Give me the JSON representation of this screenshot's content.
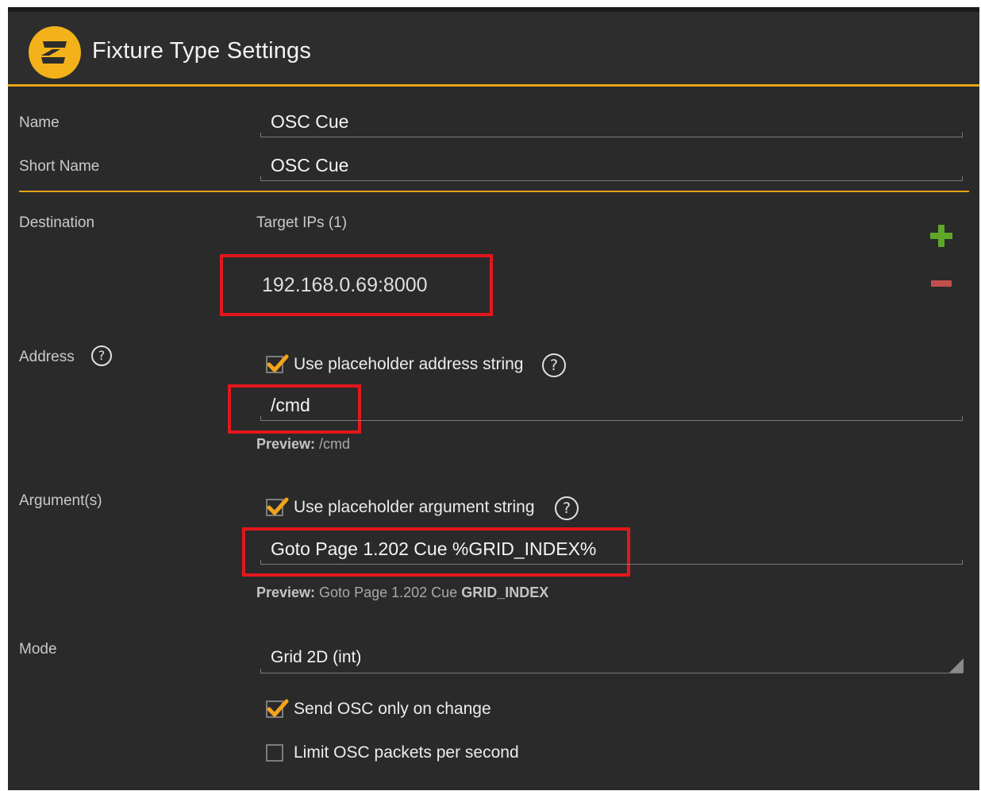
{
  "header": {
    "title": "Fixture Type Settings",
    "logo_icon": "app-logo-icon"
  },
  "name_row": {
    "label": "Name",
    "value": "OSC Cue"
  },
  "short_name_row": {
    "label": "Short Name",
    "value": "OSC Cue"
  },
  "destination": {
    "label": "Destination",
    "target_ips_label": "Target IPs (1)",
    "ip": "192.168.0.69:8000",
    "add_icon": "plus-icon",
    "remove_icon": "minus-icon"
  },
  "address": {
    "label": "Address",
    "help_glyph": "?",
    "checkbox_label": "Use placeholder address string",
    "checked": true,
    "value": "/cmd",
    "preview_label": "Preview:",
    "preview_value": " /cmd"
  },
  "arguments": {
    "label": "Argument(s)",
    "help_glyph": "?",
    "checkbox_label": "Use placeholder argument string",
    "checked": true,
    "value": "Goto Page 1.202 Cue %GRID_INDEX%",
    "preview_label": "Preview:",
    "preview_value_plain": " Goto Page 1.202 Cue ",
    "preview_value_bold": "GRID_INDEX"
  },
  "mode": {
    "label": "Mode",
    "selected": "Grid 2D (int)",
    "send_on_change_label": "Send OSC only on change",
    "send_on_change_checked": true,
    "limit_label": "Limit OSC packets per second",
    "limit_checked": false
  },
  "colors": {
    "accent": "#e8a317",
    "highlight": "#e3171c",
    "background": "#2a2a2a"
  }
}
